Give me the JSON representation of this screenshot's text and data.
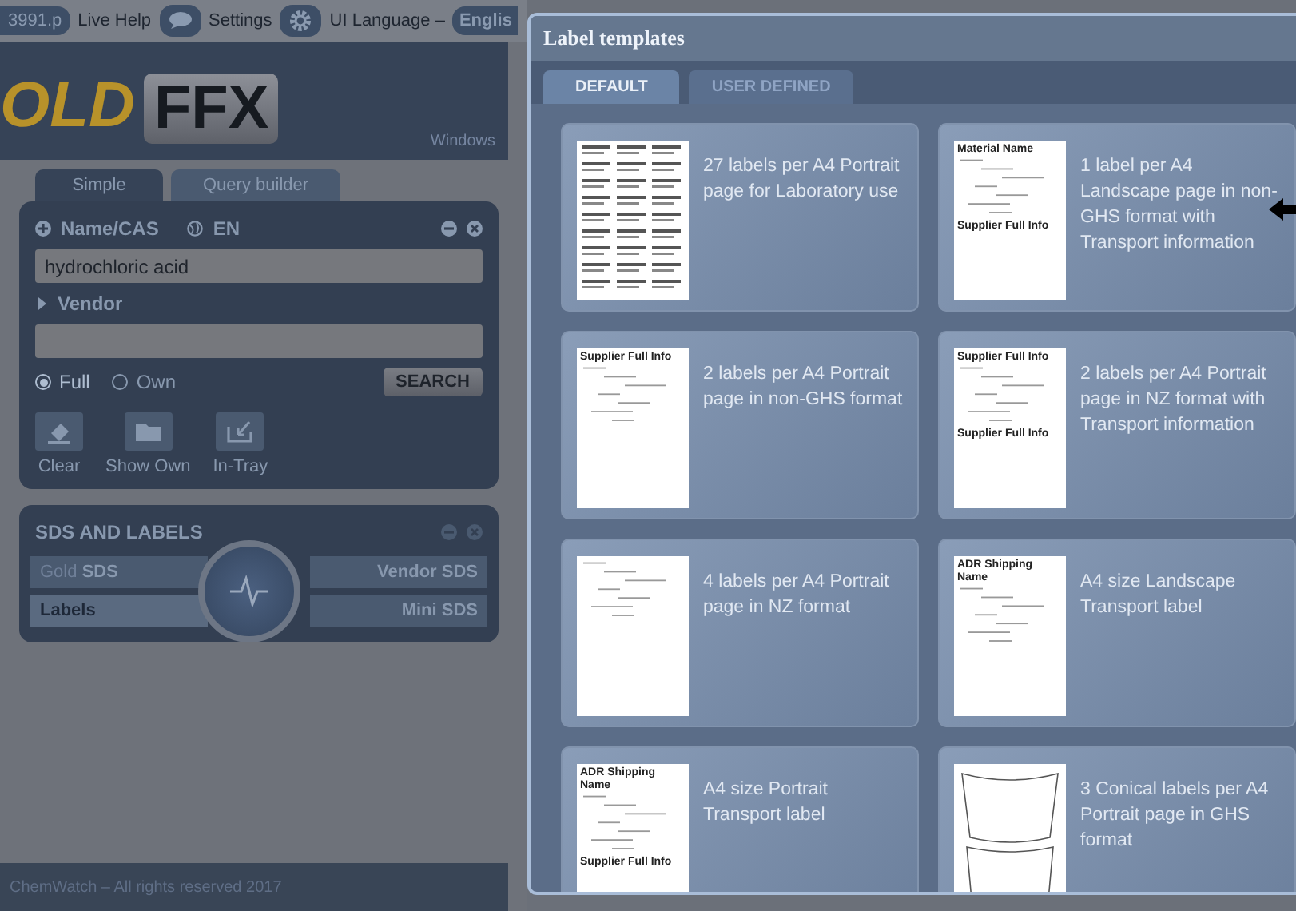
{
  "top_bar": {
    "account": "3991.p",
    "live_help": "Live Help",
    "settings": "Settings",
    "language_label": "UI Language –",
    "language": "Englis"
  },
  "logo": {
    "gold_part": "OLD",
    "ffx_part": "FFX",
    "caption": "Windows"
  },
  "search_tabs": [
    {
      "label": "Simple",
      "selected": true
    },
    {
      "label": "Query builder",
      "selected": false
    }
  ],
  "search_panel": {
    "name_label": "Name/CAS",
    "lang_label": "EN",
    "name_value": "hydrochloric acid",
    "vendor_label": "Vendor",
    "vendor_expanded": false,
    "radios": [
      {
        "label": "Full",
        "selected": true
      },
      {
        "label": "Own",
        "selected": false
      }
    ],
    "search_button": "SEARCH",
    "tools": [
      {
        "kind": "eraser",
        "label": "Clear"
      },
      {
        "kind": "folder",
        "label": "Show Own"
      },
      {
        "kind": "tray",
        "label": "In-Tray"
      }
    ]
  },
  "sds_panel": {
    "title": "SDS AND LABELS",
    "options": [
      {
        "prefix": "Gold",
        "text": "SDS",
        "selected": false
      },
      {
        "text": "Vendor SDS",
        "selected": false
      },
      {
        "text": "Labels",
        "selected": true
      },
      {
        "text": "Mini SDS",
        "selected": false
      }
    ]
  },
  "footer": "ChemWatch – All rights reserved 2017",
  "dialog": {
    "title": "Label templates",
    "tabs": [
      {
        "label": "DEFAULT",
        "selected": true
      },
      {
        "label": "USER DEFINED",
        "selected": false
      }
    ],
    "templates": [
      {
        "text": "27 labels per A4 Portrait page for Laboratory use",
        "preview": {
          "kind": "grid"
        }
      },
      {
        "text": "1 label per A4 Landscape page in non-GHS format with Transport information",
        "pointer": true,
        "preview": {
          "kind": "sheet",
          "texts": [
            "Material Name",
            "Supplier Full Info"
          ]
        }
      },
      {
        "text": "2 labels per A4 Portrait page in non-GHS format",
        "preview": {
          "kind": "sheet",
          "texts": [
            "Supplier Full Info"
          ]
        }
      },
      {
        "text": "2 labels per A4 Portrait page in NZ format with Transport information",
        "preview": {
          "kind": "sheet",
          "texts": [
            "Supplier Full Info",
            "Supplier Full Info"
          ]
        }
      },
      {
        "text": "4 labels per A4 Portrait page in NZ format",
        "preview": {
          "kind": "sheet"
        }
      },
      {
        "text": "A4 size Landscape Transport label",
        "preview": {
          "kind": "sheet",
          "texts": [
            "ADR Shipping Name"
          ]
        }
      },
      {
        "text": "A4 size Portrait Transport label",
        "preview": {
          "kind": "sheet",
          "texts": [
            "ADR Shipping Name",
            "Supplier Full Info"
          ]
        }
      },
      {
        "text": "3 Conical labels per A4 Portrait page in GHS format",
        "preview": {
          "kind": "conical"
        }
      }
    ]
  }
}
